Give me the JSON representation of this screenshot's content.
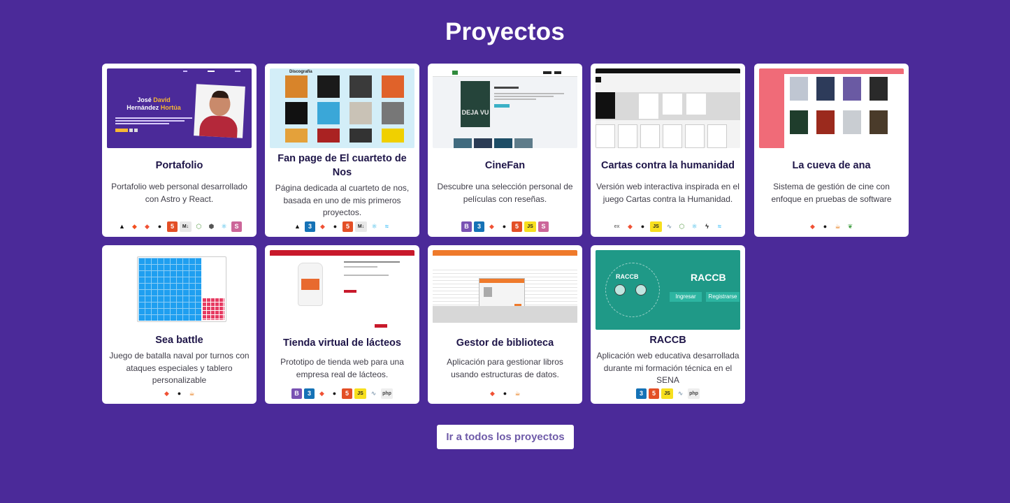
{
  "section_title": "Proyectos",
  "cta_label": "Ir a todos los proyectos",
  "projects": [
    {
      "title": "Portafolio",
      "description": "Portafolio web personal desarrollado con Astro y React.",
      "thumb": {
        "name_line1_a": "José",
        "name_line1_b": "David",
        "name_line2_a": "Hernández",
        "name_line2_b": "Hortúa"
      },
      "tech": [
        "astro-icon",
        "figma-icon",
        "git-icon",
        "github-icon",
        "html5-icon",
        "markdown-icon",
        "nodejs-icon",
        "npm-icon",
        "react-icon",
        "sass-icon"
      ]
    },
    {
      "title": "Fan page de El cuarteto de Nos",
      "description": "Página dedicada al cuarteto de nos, basada en uno de mis primeros proyectos.",
      "thumb": {
        "heading": "Discografía"
      },
      "tech": [
        "astro-icon",
        "css3-icon",
        "git-icon",
        "github-icon",
        "html5-icon",
        "markdown-icon",
        "react-icon",
        "tailwind-icon"
      ]
    },
    {
      "title": "CineFan",
      "description": "Descubre una selección personal de películas con reseñas.",
      "thumb": {
        "movie": "DEJA VU"
      },
      "tech": [
        "bootstrap-icon",
        "css3-icon",
        "git-icon",
        "github-icon",
        "html5-icon",
        "javascript-icon",
        "sass-icon"
      ]
    },
    {
      "title": "Cartas contra la humanidad",
      "description": "Versión web interactiva inspirada en el juego Cartas contra la Humanidad.",
      "tech": [
        "express-icon",
        "git-icon",
        "github-icon",
        "javascript-icon",
        "mysql-icon",
        "nodejs-icon",
        "react-icon",
        "socketio-icon",
        "tailwind-icon"
      ]
    },
    {
      "title": "La cueva de ana",
      "description": "Sistema de gestión de cine con enfoque en pruebas de software",
      "tech": [
        "git-icon",
        "github-icon",
        "java-icon",
        "mongodb-icon"
      ]
    },
    {
      "title": "Sea battle",
      "description": "Juego de batalla naval por turnos con ataques especiales y tablero personalizable",
      "tech": [
        "git-icon",
        "github-icon",
        "java-icon"
      ]
    },
    {
      "title": "Tienda virtual de lácteos",
      "description": "Prototipo de tienda web para una empresa real de lácteos.",
      "tech": [
        "bootstrap-icon",
        "css3-icon",
        "git-icon",
        "github-icon",
        "html5-icon",
        "javascript-icon",
        "mysql-icon",
        "php-icon"
      ]
    },
    {
      "title": "Gestor de biblioteca",
      "description": "Aplicación para gestionar libros usando estructuras de datos.",
      "tech": [
        "git-icon",
        "github-icon",
        "java-icon"
      ]
    },
    {
      "title": "RACCB",
      "description": "Aplicación web educativa desarrollada durante mi formación técnica en el SENA",
      "thumb": {
        "brand": "RACCB",
        "login": "Ingresar",
        "register": "Registrarse"
      },
      "tech": [
        "css3-icon",
        "html5-icon",
        "javascript-icon",
        "mysql-icon",
        "php-icon"
      ]
    }
  ],
  "tech_glyphs": {
    "astro-icon": {
      "glyph": "▲",
      "color": "#111111",
      "bg": "transparent"
    },
    "figma-icon": {
      "glyph": "◆",
      "color": "#f24e1e",
      "bg": "transparent"
    },
    "git-icon": {
      "glyph": "◆",
      "color": "#f05033",
      "bg": "transparent"
    },
    "github-icon": {
      "glyph": "●",
      "color": "#181717",
      "bg": "transparent"
    },
    "html5-icon": {
      "glyph": "5",
      "color": "#ffffff",
      "bg": "#e34f26"
    },
    "css3-icon": {
      "glyph": "3",
      "color": "#ffffff",
      "bg": "#1572b6"
    },
    "markdown-icon": {
      "glyph": "M↓",
      "color": "#222222",
      "bg": "#e8e8e8"
    },
    "nodejs-icon": {
      "glyph": "⬡",
      "color": "#5fa04e",
      "bg": "transparent"
    },
    "npm-icon": {
      "glyph": "⬢",
      "color": "#555555",
      "bg": "transparent"
    },
    "react-icon": {
      "glyph": "⚛",
      "color": "#2bb3e6",
      "bg": "transparent"
    },
    "sass-icon": {
      "glyph": "S",
      "color": "#ffffff",
      "bg": "#cc6699"
    },
    "tailwind-icon": {
      "glyph": "≈",
      "color": "#38bdf8",
      "bg": "transparent"
    },
    "bootstrap-icon": {
      "glyph": "B",
      "color": "#ffffff",
      "bg": "#7952b3"
    },
    "javascript-icon": {
      "glyph": "JS",
      "color": "#222222",
      "bg": "#f7df1e"
    },
    "express-icon": {
      "glyph": "ex",
      "color": "#777777",
      "bg": "transparent"
    },
    "mysql-icon": {
      "glyph": "∿",
      "color": "#8aa1b4",
      "bg": "transparent"
    },
    "socketio-icon": {
      "glyph": "ϟ",
      "color": "#111111",
      "bg": "transparent"
    },
    "java-icon": {
      "glyph": "☕",
      "color": "#e76f00",
      "bg": "transparent"
    },
    "mongodb-icon": {
      "glyph": "❦",
      "color": "#47a248",
      "bg": "transparent"
    },
    "php-icon": {
      "glyph": "php",
      "color": "#444444",
      "bg": "#eeeeee"
    }
  },
  "colors": {
    "background": "#4b2a99",
    "card": "#ffffff",
    "title": "#1e1548",
    "cta_text": "#6e5aa8"
  }
}
